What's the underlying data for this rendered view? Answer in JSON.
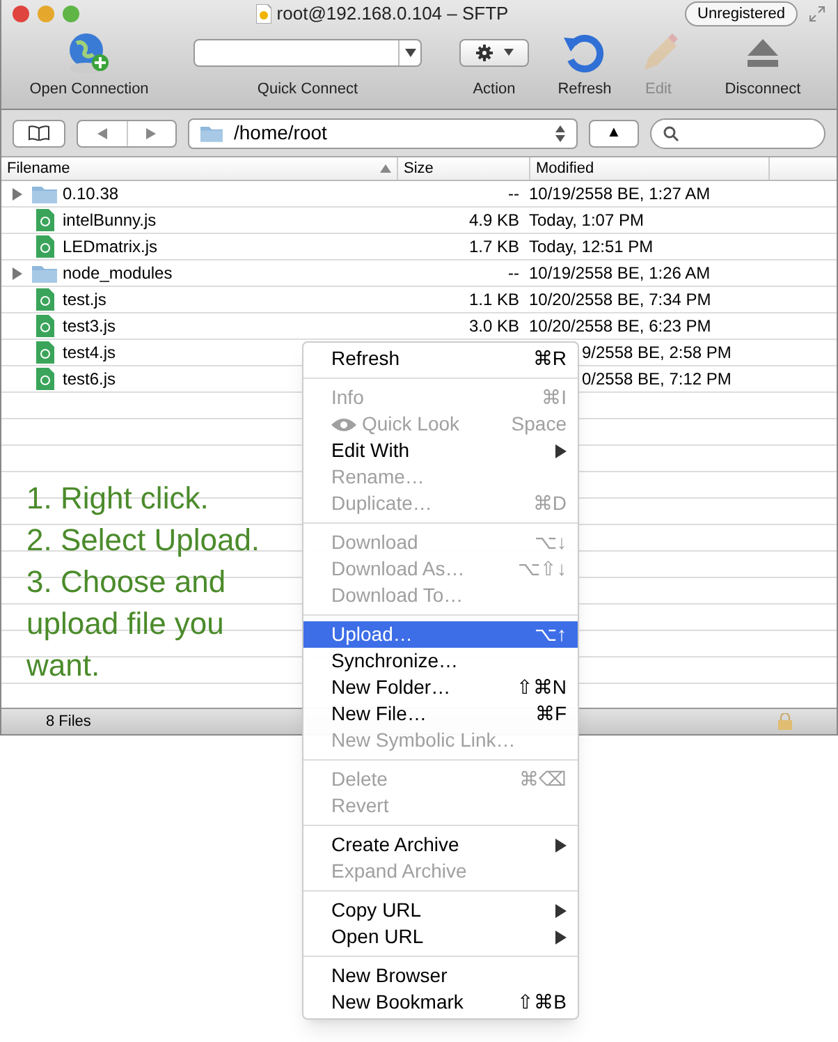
{
  "window": {
    "title": "root@192.168.0.104 – SFTP",
    "badge": "Unregistered"
  },
  "toolbar": [
    {
      "kind": "globe",
      "label": "Open Connection",
      "disabled": false
    },
    {
      "kind": "combo",
      "label": "Quick Connect",
      "disabled": false
    },
    {
      "kind": "action",
      "label": "Action",
      "disabled": false
    },
    {
      "kind": "refresh",
      "label": "Refresh",
      "disabled": false
    },
    {
      "kind": "pencil",
      "label": "Edit",
      "disabled": true
    },
    {
      "kind": "eject",
      "label": "Disconnect",
      "disabled": false
    }
  ],
  "path_bar": {
    "path": "/home/root",
    "up": "▲"
  },
  "table": {
    "columns": [
      "Filename",
      "Size",
      "Modified"
    ],
    "rows": [
      {
        "kind": "folder",
        "expanded": false,
        "name": "0.10.38",
        "size": "--",
        "modified": "10/19/2558 BE, 1:27 AM"
      },
      {
        "kind": "file",
        "name": "intelBunny.js",
        "size": "4.9 KB",
        "modified": "Today, 1:07 PM"
      },
      {
        "kind": "file",
        "name": "LEDmatrix.js",
        "size": "1.7 KB",
        "modified": "Today, 12:51 PM"
      },
      {
        "kind": "folder",
        "expanded": false,
        "name": "node_modules",
        "size": "--",
        "modified": "10/19/2558 BE, 1:26 AM"
      },
      {
        "kind": "file",
        "name": "test.js",
        "size": "1.1 KB",
        "modified": "10/20/2558 BE, 7:34 PM"
      },
      {
        "kind": "file",
        "name": "test3.js",
        "size": "3.0 KB",
        "modified": "10/20/2558 BE, 6:23 PM"
      },
      {
        "kind": "file",
        "name": "test4.js",
        "modified_visible": "9/2558 BE, 2:58 PM"
      },
      {
        "kind": "file",
        "name": "test6.js",
        "modified_visible": "0/2558 BE, 7:12 PM"
      }
    ]
  },
  "instructions": [
    "1. Right click.",
    "2. Select Upload.",
    "3. Choose and upload file you want."
  ],
  "status_bar": {
    "text": "8 Files",
    "locked": true
  },
  "context_menu": [
    [
      {
        "label": "Refresh",
        "shortcut": "⌘R",
        "disabled": false,
        "highlighted": false,
        "submenu": false
      }
    ],
    [
      {
        "label": "Info",
        "shortcut": "⌘I",
        "disabled": true,
        "highlighted": false,
        "submenu": false
      },
      {
        "label": "Quick Look",
        "shortcut": "Space",
        "disabled": true,
        "highlighted": false,
        "submenu": false,
        "kind": "preview"
      },
      {
        "label": "Edit With",
        "disabled": false,
        "highlighted": false,
        "submenu": true
      },
      {
        "label": "Rename…",
        "disabled": true,
        "highlighted": false,
        "submenu": false
      },
      {
        "label": "Duplicate…",
        "shortcut": "⌘D",
        "disabled": true,
        "highlighted": false,
        "submenu": false
      }
    ],
    [
      {
        "label": "Download",
        "shortcut": "⌥↓",
        "disabled": true,
        "highlighted": false,
        "submenu": false
      },
      {
        "label": "Download As…",
        "shortcut": "⌥⇧↓",
        "disabled": true,
        "highlighted": false,
        "submenu": false
      },
      {
        "label": "Download To…",
        "disabled": true,
        "highlighted": false,
        "submenu": false
      }
    ],
    [
      {
        "label": "Upload…",
        "shortcut": "⌥↑",
        "disabled": false,
        "highlighted": true,
        "submenu": false
      },
      {
        "label": "Synchronize…",
        "disabled": false,
        "highlighted": false,
        "submenu": false
      },
      {
        "label": "New Folder…",
        "shortcut": "⇧⌘N",
        "disabled": false,
        "highlighted": false,
        "submenu": false
      },
      {
        "label": "New File…",
        "shortcut": "⌘F",
        "disabled": false,
        "highlighted": false,
        "submenu": false
      },
      {
        "label": "New Symbolic Link…",
        "disabled": true,
        "highlighted": false,
        "submenu": false
      }
    ],
    [
      {
        "label": "Delete",
        "shortcut": "⌘⌫",
        "disabled": true,
        "highlighted": false,
        "submenu": false
      },
      {
        "label": "Revert",
        "disabled": true,
        "highlighted": false,
        "submenu": false
      }
    ],
    [
      {
        "label": "Create Archive",
        "disabled": false,
        "highlighted": false,
        "submenu": true
      },
      {
        "label": "Expand Archive",
        "disabled": true,
        "highlighted": false,
        "submenu": false
      }
    ],
    [
      {
        "label": "Copy URL",
        "disabled": false,
        "highlighted": false,
        "submenu": true
      },
      {
        "label": "Open URL",
        "disabled": false,
        "highlighted": false,
        "submenu": true
      }
    ],
    [
      {
        "label": "New Browser",
        "disabled": false,
        "highlighted": false,
        "submenu": false
      },
      {
        "label": "New Bookmark",
        "shortcut": "⇧⌘B",
        "disabled": false,
        "highlighted": false,
        "submenu": false
      }
    ]
  ]
}
